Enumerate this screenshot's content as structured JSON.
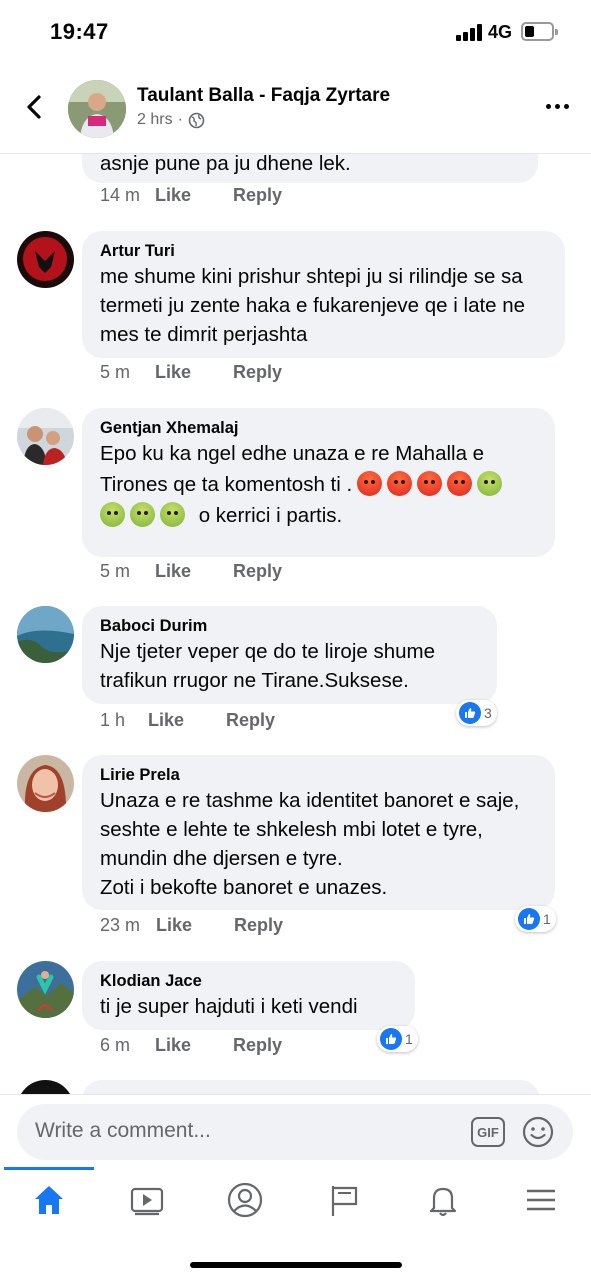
{
  "status_bar": {
    "time": "19:47",
    "network": "4G"
  },
  "header": {
    "page_name": "Taulant Balla - Faqja Zyrtare",
    "post_time": "2 hrs",
    "privacy_icon": "globe-icon"
  },
  "comments": [
    {
      "author": "",
      "text": "asnje pune pa ju dhene lek.",
      "time": "14 m",
      "like": "Like",
      "reply": "Reply"
    },
    {
      "author": "Artur Turi",
      "text": "me shume kini prishur shtepi ju si rilindje se sa termeti ju zente haka e fukarenjeve qe i late ne mes te dimrit perjashta",
      "time": "5 m",
      "like": "Like",
      "reply": "Reply"
    },
    {
      "author": "Gentjan Xhemalaj",
      "text_line1": "Epo ku ka ngel edhe unaza e re Mahalla e",
      "text_line2": "Tirones qe ta komentosh ti .",
      "text_line3": "o kerrici i partis.",
      "time": "5 m",
      "like": "Like",
      "reply": "Reply"
    },
    {
      "author": "Baboci Durim",
      "text": "Nje tjeter veper qe do te liroje shume trafikun rrugor ne Tirane.Suksese.",
      "time": "1 h",
      "like": "Like",
      "reply": "Reply",
      "reactions": "3"
    },
    {
      "author": "Lirie Prela",
      "text": "Unaza e re tashme ka identitet banoret e saje, seshte e lehte te shkelesh mbi lotet e tyre, mundin dhe djersen e tyre.",
      "text2": "Zoti i bekofte banoret e unazes.",
      "time": "23 m",
      "like": "Like",
      "reply": "Reply",
      "reactions": "1"
    },
    {
      "author": "Klodian Jace",
      "text": "ti je super hajduti  i keti vendi",
      "time": "6 m",
      "like": "Like",
      "reply": "Reply",
      "reactions": "1"
    }
  ],
  "composer": {
    "placeholder": "Write a comment...",
    "gif_label": "GIF"
  },
  "tabs": [
    {
      "icon": "home-icon",
      "active": true
    },
    {
      "icon": "watch-icon",
      "active": false
    },
    {
      "icon": "profile-icon",
      "active": false
    },
    {
      "icon": "pages-flag-icon",
      "active": false
    },
    {
      "icon": "notifications-bell-icon",
      "active": false
    },
    {
      "icon": "menu-icon",
      "active": false
    }
  ],
  "colors": {
    "accent": "#1877f2",
    "bubble": "#f0f2f5",
    "meta": "#65676b"
  }
}
